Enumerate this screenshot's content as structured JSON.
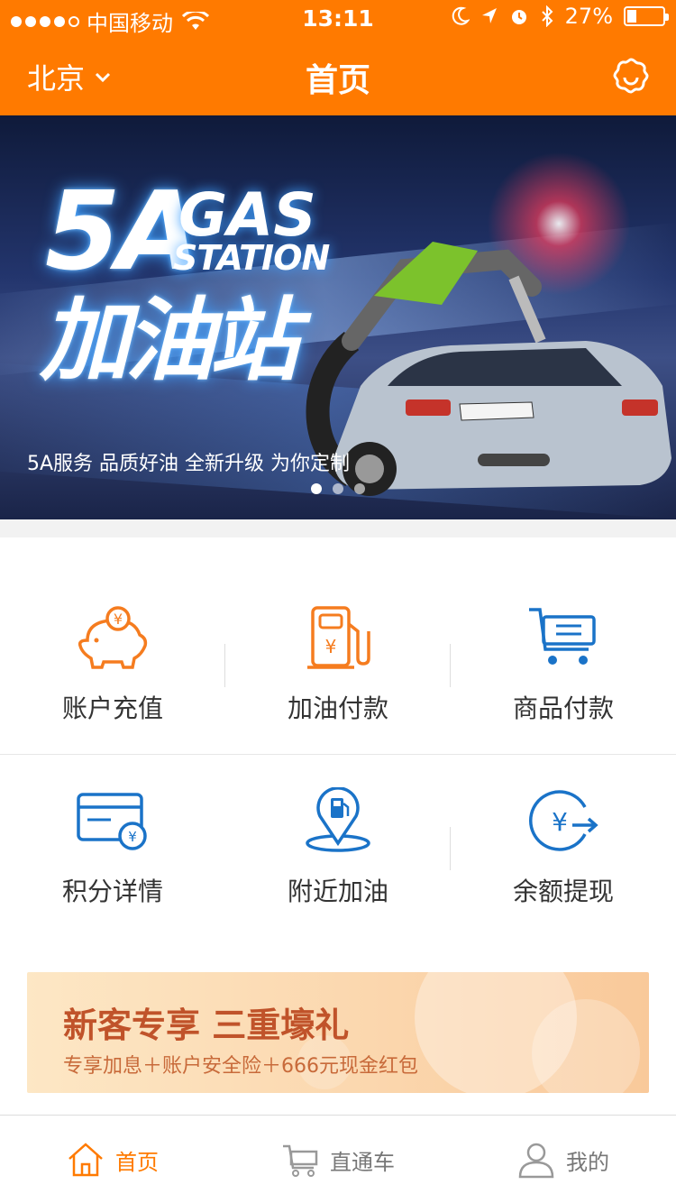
{
  "status_bar": {
    "carrier": "中国移动",
    "time": "13:11",
    "battery_text": "27%",
    "battery_level": 0.27
  },
  "nav": {
    "city": "北京",
    "title": "首页",
    "settings_icon": "flower-settings-icon"
  },
  "banner": {
    "logo_5a": "5A",
    "logo_gas": "GAS",
    "logo_station": "STATION",
    "logo_cn": "加油站",
    "caption": "5A服务 品质好油 全新升级 为你定制",
    "page_count": 3,
    "active_page": 0
  },
  "functions": [
    {
      "label": "账户充值",
      "icon": "piggy-bank-icon"
    },
    {
      "label": "加油付款",
      "icon": "fuel-pump-icon"
    },
    {
      "label": "商品付款",
      "icon": "shopping-cart-icon"
    },
    {
      "label": "积分详情",
      "icon": "card-points-icon"
    },
    {
      "label": "附近加油",
      "icon": "location-fuel-icon"
    },
    {
      "label": "余额提现",
      "icon": "withdraw-yen-icon"
    }
  ],
  "promo": {
    "title": "新客专享 三重壕礼",
    "subtitle": "专享加息＋账户安全险＋666元现金红包"
  },
  "tabs": [
    {
      "label": "首页",
      "icon": "home-icon",
      "active": true
    },
    {
      "label": "直通车",
      "icon": "cart-icon",
      "active": false
    },
    {
      "label": "我的",
      "icon": "user-icon",
      "active": false
    }
  ],
  "colors": {
    "accent": "#ff7a00",
    "icon_orange": "#f57c1f",
    "icon_blue": "#1a73c8",
    "promo_text": "#c0532a"
  }
}
